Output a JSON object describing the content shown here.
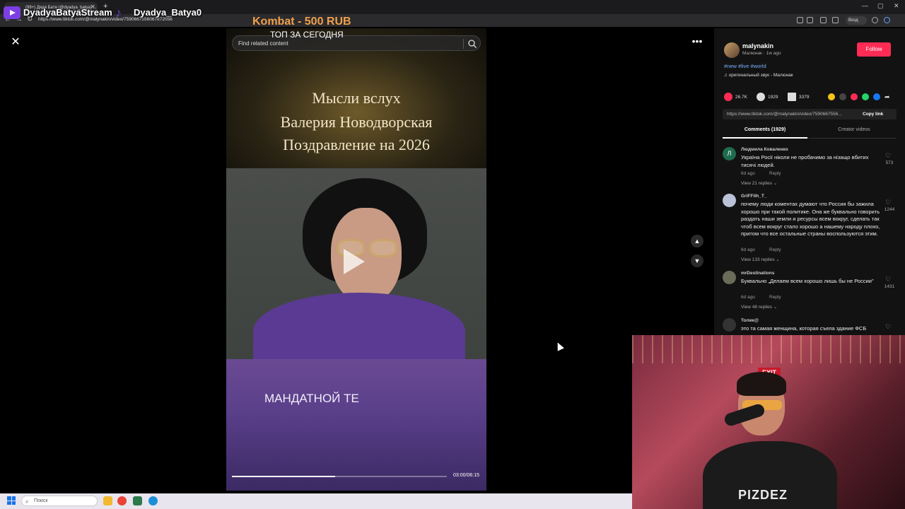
{
  "browser": {
    "tab_title": "(99+) Дядя Батя (@dyadya_batya) ...",
    "url": "https://www.tiktok.com/@malynakin/video/7590667556067872056",
    "profile_label": "Вход"
  },
  "overlay": {
    "stream_name": "DyadyaBatyaStream",
    "tiktok_name": "Dyadya_Batya0",
    "kombat": "Kombat - 500 RUB",
    "top_today": "ТОП ЗА СЕГОДНЯ"
  },
  "player": {
    "search_placeholder": "Find related content",
    "title_lines": [
      "Мысли вслух",
      "Валерия Новодворская",
      "Поздравление на 2026"
    ],
    "caption": "МАНДАТНОЙ ТЕ",
    "time": "03:00/06:15",
    "progress": 0.48
  },
  "panel": {
    "username": "malynakin",
    "subtitle": "Малюнак · 1w ago",
    "follow_label": "Follow",
    "tags": "#new #live #world",
    "sound": "оригинальный звук - Малюнак",
    "likes": "26.7K",
    "comments_count": "1929",
    "saves": "3379",
    "link": "https://www.tiktok.com/@malynakin/video/7590667556...",
    "copy_label": "Copy link",
    "tab_comments": "Comments (1929)",
    "tab_creator": "Creator videos",
    "reply_label": "Reply",
    "comments": [
      {
        "name": "Людмила Коваленко",
        "avatar": "Л",
        "text": "Україна Росії ніколи не пробачимо за нізащо вбитих тисячі людей.",
        "age": "6d ago",
        "likes": "573",
        "view": "View 21 replies"
      },
      {
        "name": "GriFFith_T_",
        "avatar": "",
        "text": "почему люди коментах думают что Россия бы зажила хорошо при такой политике. Она же буквально говорить раздать наши земли и ресурсы всем вокруг, сделать так чтоб всем вокруг стало хорошо а нашему народу плохо, притом что все остальные страны воспользуются этим.",
        "age": "6d ago",
        "likes": "1244",
        "view": "View 133 replies"
      },
      {
        "name": "mrDestinations",
        "avatar": "",
        "text": "Буквально „Делаем всем хорошо лишь бы не России\"",
        "age": "6d ago",
        "likes": "1431",
        "view": "View 48 replies"
      },
      {
        "name": "Толик@",
        "avatar": "",
        "text": "это та самая женщина, которая съела здание ФСБ",
        "age": "",
        "likes": "",
        "view": ""
      }
    ]
  },
  "webcam": {
    "exit_sign": "EXIT",
    "shirt_text": "PIZDEZ"
  },
  "taskbar": {
    "search_label": "Поиск"
  }
}
